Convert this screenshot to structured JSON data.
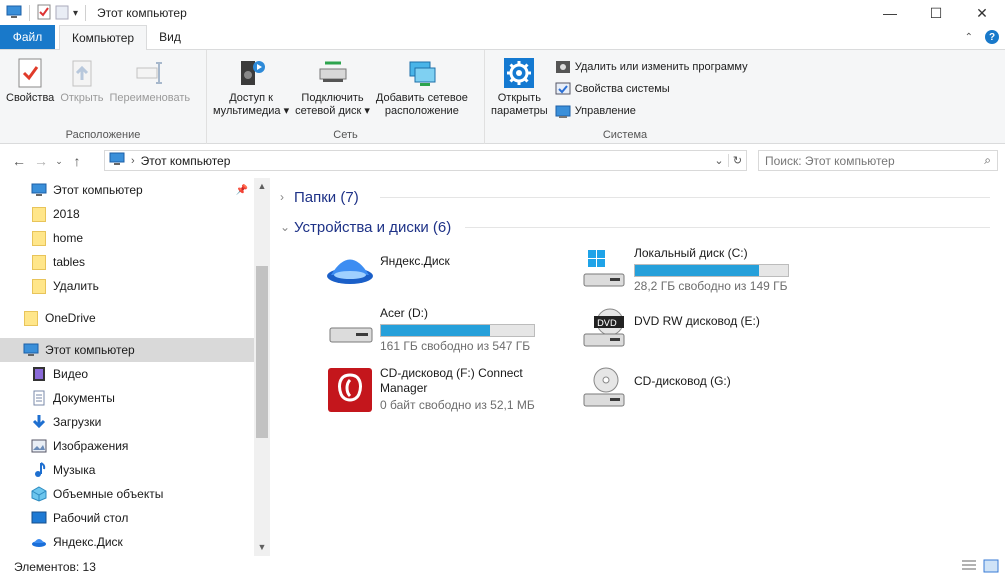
{
  "window": {
    "title": "Этот компьютер",
    "controls": {
      "minimize": "—",
      "maximize": "☐",
      "close": "✕"
    }
  },
  "ribbon_tabs": [
    {
      "label": "Файл",
      "kind": "file"
    },
    {
      "label": "Компьютер",
      "kind": "active"
    },
    {
      "label": "Вид",
      "kind": "normal"
    }
  ],
  "ribbon": {
    "location": {
      "label": "Расположение",
      "buttons": [
        {
          "label": "Свойства",
          "icon": "properties-icon",
          "enabled": true
        },
        {
          "label": "Открыть",
          "icon": "open-icon",
          "enabled": false
        },
        {
          "label": "Переименовать",
          "icon": "rename-icon",
          "enabled": false
        }
      ]
    },
    "network": {
      "label": "Сеть",
      "buttons": [
        {
          "label": "Доступ к\nмультимедиа ▾",
          "icon": "media-access-icon"
        },
        {
          "label": "Подключить\nсетевой диск ▾",
          "icon": "map-network-drive-icon"
        },
        {
          "label": "Добавить сетевое\nрасположение",
          "icon": "add-network-location-icon"
        }
      ]
    },
    "system": {
      "label": "Система",
      "open_settings": "Открыть\nпараметры",
      "items": [
        {
          "label": "Удалить или изменить программу",
          "icon": "uninstall-program-icon"
        },
        {
          "label": "Свойства системы",
          "icon": "system-properties-icon"
        },
        {
          "label": "Управление",
          "icon": "manage-icon"
        }
      ]
    }
  },
  "address": {
    "path": "Этот компьютер",
    "search_placeholder": "Поиск: Этот компьютер"
  },
  "nav": {
    "items": [
      {
        "label": "Этот компьютер",
        "icon": "computer-icon",
        "indent": 1,
        "pinned": true
      },
      {
        "label": "2018",
        "icon": "folder-icon",
        "indent": 1
      },
      {
        "label": "home",
        "icon": "folder-icon",
        "indent": 1
      },
      {
        "label": "tables",
        "icon": "folder-icon",
        "indent": 1
      },
      {
        "label": "Удалить",
        "icon": "folder-icon",
        "indent": 1
      },
      {
        "label": "OneDrive",
        "icon": "folder-icon",
        "indent": 0
      },
      {
        "label": "Этот компьютер",
        "icon": "computer-icon",
        "indent": 0,
        "selected": true
      },
      {
        "label": "Видео",
        "icon": "video-icon",
        "indent": 1
      },
      {
        "label": "Документы",
        "icon": "documents-icon",
        "indent": 1
      },
      {
        "label": "Загрузки",
        "icon": "downloads-icon",
        "indent": 1
      },
      {
        "label": "Изображения",
        "icon": "images-icon",
        "indent": 1
      },
      {
        "label": "Музыка",
        "icon": "music-icon",
        "indent": 1
      },
      {
        "label": "Объемные объекты",
        "icon": "3d-objects-icon",
        "indent": 1
      },
      {
        "label": "Рабочий стол",
        "icon": "desktop-icon",
        "indent": 1
      },
      {
        "label": "Яндекс.Диск",
        "icon": "yandex-disk-icon",
        "indent": 1
      }
    ]
  },
  "content": {
    "folders_header": "Папки (7)",
    "devices_header": "Устройства и диски (6)",
    "drives": [
      {
        "name": "Яндекс.Диск",
        "free": "",
        "used_fraction": null,
        "icon": "yandex-disk-icon"
      },
      {
        "name": "Локальный диск (C:)",
        "free": "28,2 ГБ свободно из 149 ГБ",
        "used_fraction": 0.81,
        "icon": "windows-drive-icon"
      },
      {
        "name": "Acer (D:)",
        "free": "161 ГБ свободно из 547 ГБ",
        "used_fraction": 0.71,
        "icon": "hard-drive-icon"
      },
      {
        "name": "DVD RW дисковод (E:)",
        "free": "",
        "used_fraction": null,
        "icon": "dvd-drive-icon"
      },
      {
        "name": "CD-дисковод (F:) Connect\nManager",
        "free": "0 байт свободно из 52,1 МБ",
        "used_fraction": null,
        "icon": "connect-manager-icon"
      },
      {
        "name": "CD-дисковод (G:)",
        "free": "",
        "used_fraction": null,
        "icon": "cd-drive-icon"
      }
    ]
  },
  "status": {
    "items_count": "Элементов: 13"
  },
  "colors": {
    "accent": "#1979ca",
    "progress": "#26a0da",
    "header_text": "#1e3287"
  }
}
